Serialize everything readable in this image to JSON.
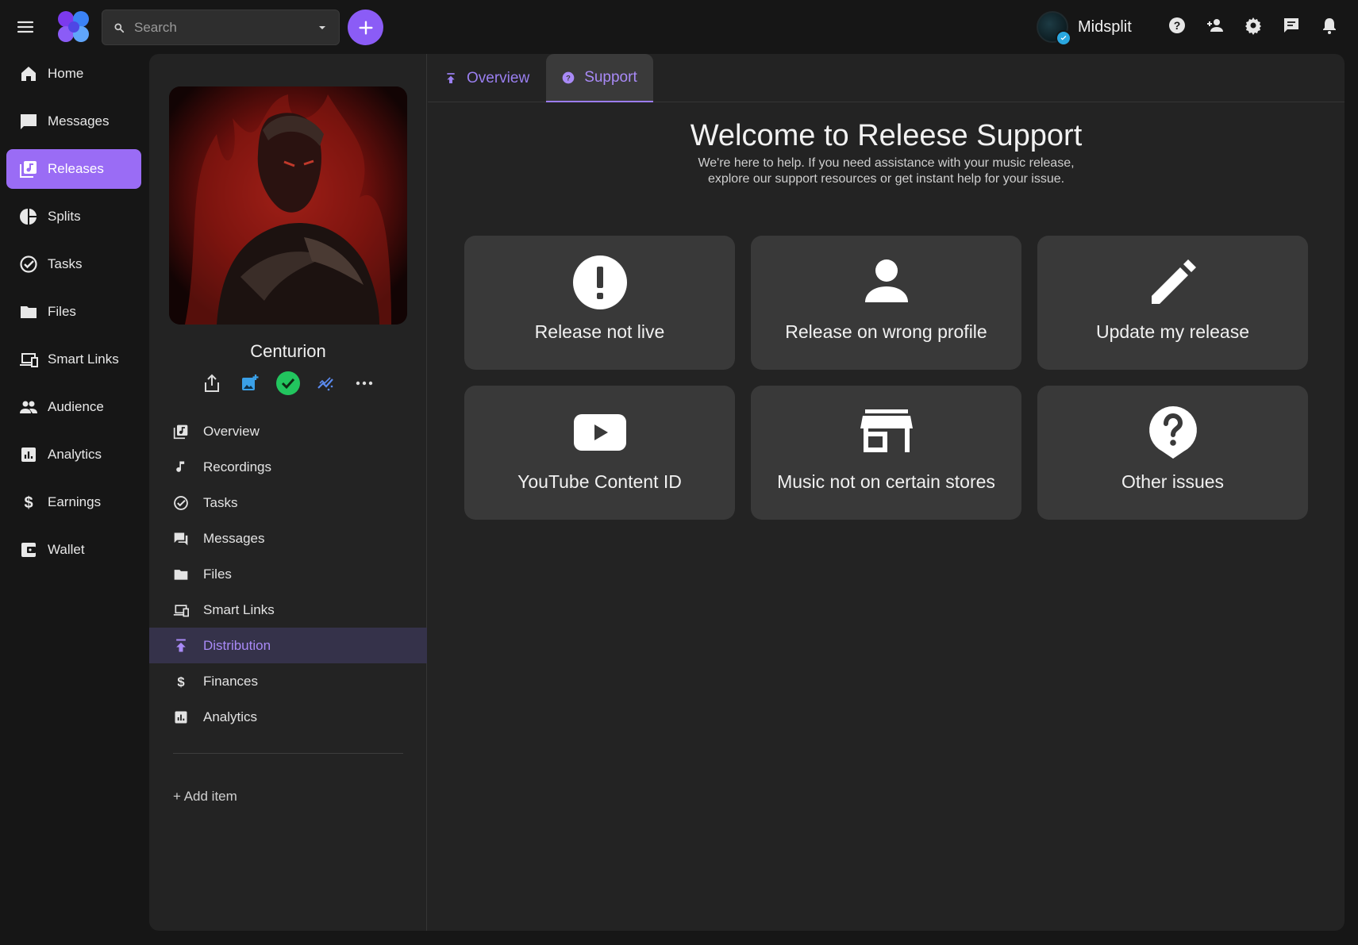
{
  "topbar": {
    "search_placeholder": "Search",
    "user_name": "Midsplit",
    "accent_color": "#8b5cf6"
  },
  "leftnav": {
    "items": [
      {
        "label": "Home",
        "icon": "home-icon"
      },
      {
        "label": "Messages",
        "icon": "chat-bubble-icon"
      },
      {
        "label": "Releases",
        "icon": "releases-icon",
        "active": true
      },
      {
        "label": "Splits",
        "icon": "pie-chart-icon"
      },
      {
        "label": "Tasks",
        "icon": "check-circle-icon"
      },
      {
        "label": "Files",
        "icon": "folder-icon"
      },
      {
        "label": "Smart Links",
        "icon": "devices-icon"
      },
      {
        "label": "Audience",
        "icon": "people-icon"
      },
      {
        "label": "Analytics",
        "icon": "bar-chart-icon"
      },
      {
        "label": "Earnings",
        "icon": "dollar-icon"
      },
      {
        "label": "Wallet",
        "icon": "wallet-icon"
      }
    ]
  },
  "release": {
    "title": "Centurion",
    "menu": [
      {
        "label": "Overview",
        "icon": "releases-icon"
      },
      {
        "label": "Recordings",
        "icon": "music-note-icon"
      },
      {
        "label": "Tasks",
        "icon": "check-circle-icon"
      },
      {
        "label": "Messages",
        "icon": "forum-icon"
      },
      {
        "label": "Files",
        "icon": "folder-icon"
      },
      {
        "label": "Smart Links",
        "icon": "devices-icon"
      },
      {
        "label": "Distribution",
        "icon": "publish-icon",
        "active": true
      },
      {
        "label": "Finances",
        "icon": "dollar-icon"
      },
      {
        "label": "Analytics",
        "icon": "bar-chart-icon"
      }
    ],
    "add_item": "+ Add item"
  },
  "tabs": [
    {
      "label": "Overview",
      "icon": "publish-icon"
    },
    {
      "label": "Support",
      "icon": "help-circle-icon",
      "active": true
    }
  ],
  "support": {
    "title": "Welcome to Releese Support",
    "text": "We're here to help. If you need assistance with your music release, explore our support resources or get instant help for your issue.",
    "cards": [
      {
        "label": "Release not live",
        "icon": "alert-circle-icon"
      },
      {
        "label": "Release on wrong profile",
        "icon": "person-icon"
      },
      {
        "label": "Update my release",
        "icon": "pencil-icon"
      },
      {
        "label": "YouTube Content ID",
        "icon": "youtube-icon"
      },
      {
        "label": "Music not on certain stores",
        "icon": "store-icon"
      },
      {
        "label": "Other issues",
        "icon": "question-icon"
      }
    ]
  }
}
